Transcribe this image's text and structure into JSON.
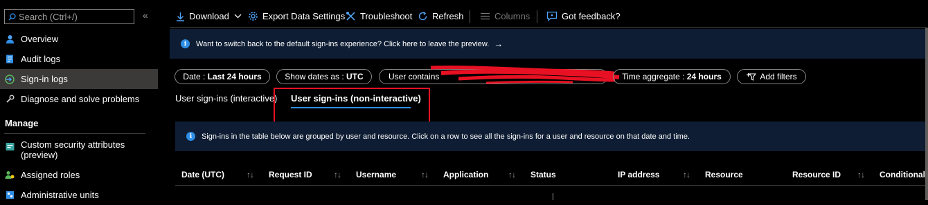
{
  "sidebar": {
    "search_placeholder": "Search (Ctrl+/)",
    "collapse_glyph": "«",
    "items": [
      {
        "label": "Overview",
        "icon": "person-icon"
      },
      {
        "label": "Audit logs",
        "icon": "document-icon"
      },
      {
        "label": "Sign-in logs",
        "icon": "sign-in-icon",
        "selected": true
      },
      {
        "label": "Diagnose and solve problems",
        "icon": "wrench-icon"
      }
    ],
    "section_label": "Manage",
    "manage_items": [
      {
        "label_line1": "Custom security attributes",
        "label_line2": "(preview)",
        "icon": "security-attributes-icon"
      },
      {
        "label": "Assigned roles",
        "icon": "roles-icon"
      },
      {
        "label": "Administrative units",
        "icon": "admin-units-icon"
      }
    ]
  },
  "toolbar": {
    "download": "Download",
    "export": "Export Data Settings",
    "troubleshoot": "Troubleshoot",
    "refresh": "Refresh",
    "columns": "Columns",
    "feedback": "Got feedback?"
  },
  "preview_banner": {
    "text": "Want to switch back to the default sign-ins experience? Click here to leave the preview.",
    "arrow": "→"
  },
  "filters": {
    "date_label": "Date : ",
    "date_value": "Last 24 hours",
    "show_dates_label": "Show dates as : ",
    "show_dates_value": "UTC",
    "user_label": "User contains",
    "time_aggregate_label": "Time aggregate : ",
    "time_aggregate_value": "24 hours",
    "add_filters": "Add filters"
  },
  "tabs": {
    "interactive": "User sign-ins (interactive)",
    "non_interactive": "User sign-ins (non-interactive)"
  },
  "grouped_banner": {
    "text": "Sign-ins in the table below are grouped by user and resource. Click on a row to see all the sign-ins for a user and resource on that date and time."
  },
  "table": {
    "columns": [
      "Date (UTC)",
      "Request ID",
      "Username",
      "Application",
      "Status",
      "IP address",
      "Resource",
      "Resource ID",
      "Conditional A"
    ],
    "sort_glyph": "↑↓"
  },
  "colors": {
    "accent": "#2f8fe6",
    "highlight_border": "#e81123",
    "banner_bg": "#0e1d33",
    "selected_bg": "#3b3a39"
  }
}
